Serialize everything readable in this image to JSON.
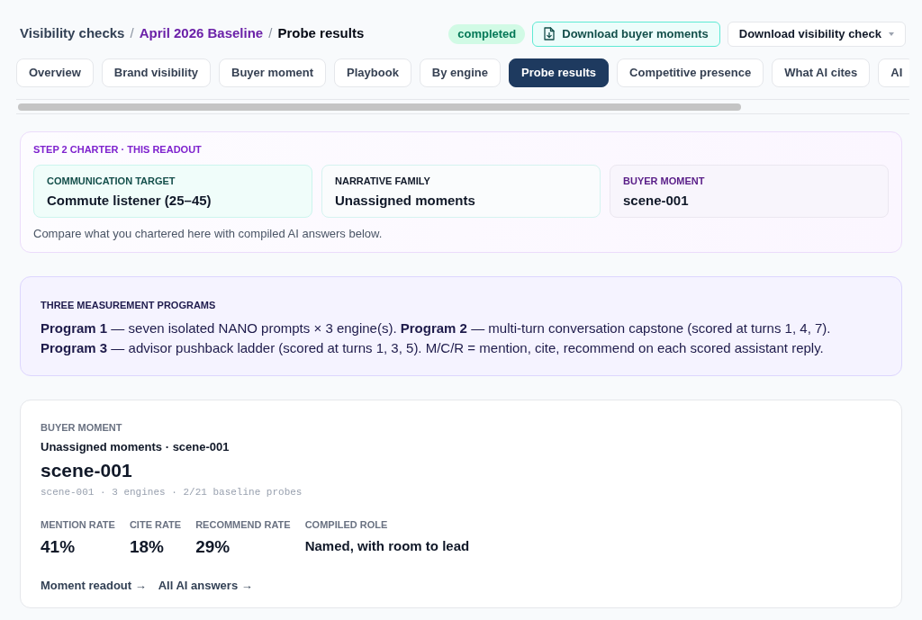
{
  "breadcrumb": [
    {
      "kind": "section",
      "label": "Visibility checks"
    },
    {
      "kind": "separator",
      "label": "/"
    },
    {
      "kind": "run",
      "label": "April 2026 Baseline"
    },
    {
      "kind": "separator",
      "label": "/"
    },
    {
      "kind": "current",
      "label": "Probe results"
    }
  ],
  "status_badge": {
    "label": "completed"
  },
  "actions": [
    {
      "kind": "download",
      "label": "Download buyer moments"
    },
    {
      "kind": "dropdown",
      "label": "Download visibility check"
    }
  ],
  "tabs": [
    {
      "label": "Overview",
      "selected": false
    },
    {
      "label": "Brand visibility",
      "selected": false
    },
    {
      "label": "Buyer moment",
      "selected": false
    },
    {
      "label": "Playbook",
      "selected": false
    },
    {
      "label": "By engine",
      "selected": false
    },
    {
      "label": "Probe results",
      "selected": true
    },
    {
      "label": "Competitive presence",
      "selected": false
    },
    {
      "label": "What AI cites",
      "selected": false
    },
    {
      "label": "AI",
      "selected": false
    }
  ],
  "charter": {
    "title": "STEP 2 CHARTER · THIS READOUT",
    "communication_target": {
      "label": "COMMUNICATION TARGET",
      "value": "Commute listener (25–45)"
    },
    "narrative_family": {
      "label": "NARRATIVE FAMILY",
      "value": "Unassigned moments"
    },
    "buyer_moment": {
      "label": "BUYER MOMENT",
      "value": "scene-001"
    },
    "note": "Compare what you chartered here with compiled AI answers below."
  },
  "programs": {
    "title": "THREE MEASUREMENT PROGRAMS",
    "text": "**Program 1** — seven isolated NANO prompts × 3 engine(s). **Program 2** — multi-turn conversation capstone (scored at turns 1, 4, 7). **Program 3** — advisor pushback ladder (scored at turns 1, 3, 5). M/C/R = mention, cite, recommend on each scored assistant reply."
  },
  "moment_card": {
    "eyebrow": "BUYER MOMENT",
    "subtitle": "Unassigned moments · scene-001",
    "title": "scene-001",
    "meta": "scene-001 · 3 engines · 2/21 baseline probes",
    "metrics": [
      {
        "label": "MENTION RATE",
        "value": "41%"
      },
      {
        "label": "CITE RATE",
        "value": "18%"
      },
      {
        "label": "RECOMMEND RATE",
        "value": "29%"
      }
    ],
    "role": {
      "label": "COMPILED ROLE",
      "value": "Named, with room to lead"
    },
    "links": [
      "Moment readout →",
      "All AI answers →"
    ]
  }
}
